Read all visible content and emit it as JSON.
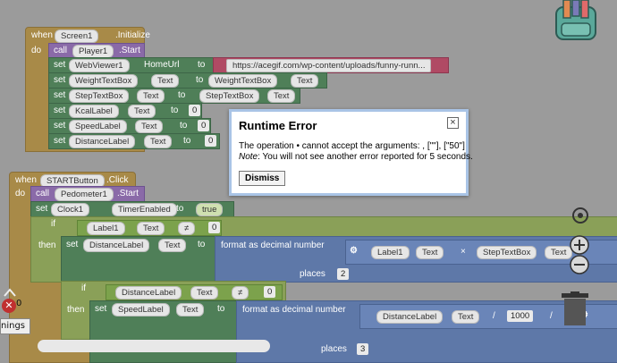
{
  "screen_init": {
    "when": "when",
    "component": "Screen1",
    "event": ".Initialize",
    "do": "do"
  },
  "player_call": {
    "call": "call",
    "component": "Player1",
    "method": ".Start"
  },
  "init_sets": [
    {
      "set": "set",
      "comp": "WebViewer1",
      "prop": "HomeUrl",
      "to": "to",
      "value": "https://acegif.com/wp-content/uploads/funny-runn..."
    },
    {
      "set": "set",
      "comp": "WeightTextBox",
      "prop": "Text",
      "to": "to",
      "value_comp": "WeightTextBox",
      "value_prop": "Text"
    },
    {
      "set": "set",
      "comp": "StepTextBox",
      "prop": "Text",
      "to": "to",
      "value_comp": "StepTextBox",
      "value_prop": "Text"
    },
    {
      "set": "set",
      "comp": "KcalLabel",
      "prop": "Text",
      "to": "to",
      "value": "0"
    },
    {
      "set": "set",
      "comp": "SpeedLabel",
      "prop": "Text",
      "to": "to",
      "value": "0"
    },
    {
      "set": "set",
      "comp": "DistanceLabel",
      "prop": "Text",
      "to": "to",
      "value": "0"
    }
  ],
  "start_btn": {
    "when": "when",
    "component": "STARTButton",
    "event": ".Click",
    "do": "do"
  },
  "pedometer_call": {
    "call": "call",
    "component": "Pedometer1",
    "method": ".Start"
  },
  "clock_set": {
    "set": "set",
    "comp": "Clock1",
    "prop": "TimerEnabled",
    "to": "to",
    "value": "true"
  },
  "if1": {
    "if": "if",
    "then": "then",
    "comp": "Label1",
    "prop": "Text",
    "op": "≠",
    "value": "0"
  },
  "then1": {
    "set": "set",
    "comp": "DistanceLabel",
    "prop": "Text",
    "to": "to",
    "format": "format as decimal number",
    "number": "number",
    "places": "places",
    "places_val": "2",
    "mul_comp1": "Label1",
    "mul_prop1": "Text",
    "op": "×",
    "mul_comp2": "StepTextBox",
    "mul_prop2": "Text"
  },
  "if2": {
    "if": "if",
    "then": "then",
    "comp": "DistanceLabel",
    "prop": "Text",
    "op": "≠",
    "value": "0"
  },
  "then2": {
    "set": "set",
    "comp": "SpeedLabel",
    "prop": "Text",
    "to": "to",
    "format": "format as decimal number",
    "number": "number",
    "places": "places",
    "places_val": "3",
    "div_comp": "DistanceLabel",
    "div_prop": "Text",
    "op": "/",
    "div_val": "1000",
    "op2": "/"
  },
  "warnings": {
    "count": "0",
    "label": "nings"
  },
  "error_dialog": {
    "title": "Runtime Error",
    "close": "×",
    "message": "The operation • cannot accept the arguments: , [\"\"], [\"50\"]",
    "note_label": "Note",
    "note_text": ": You will not see another error reported for 5 seconds.",
    "dismiss": "Dismiss"
  }
}
